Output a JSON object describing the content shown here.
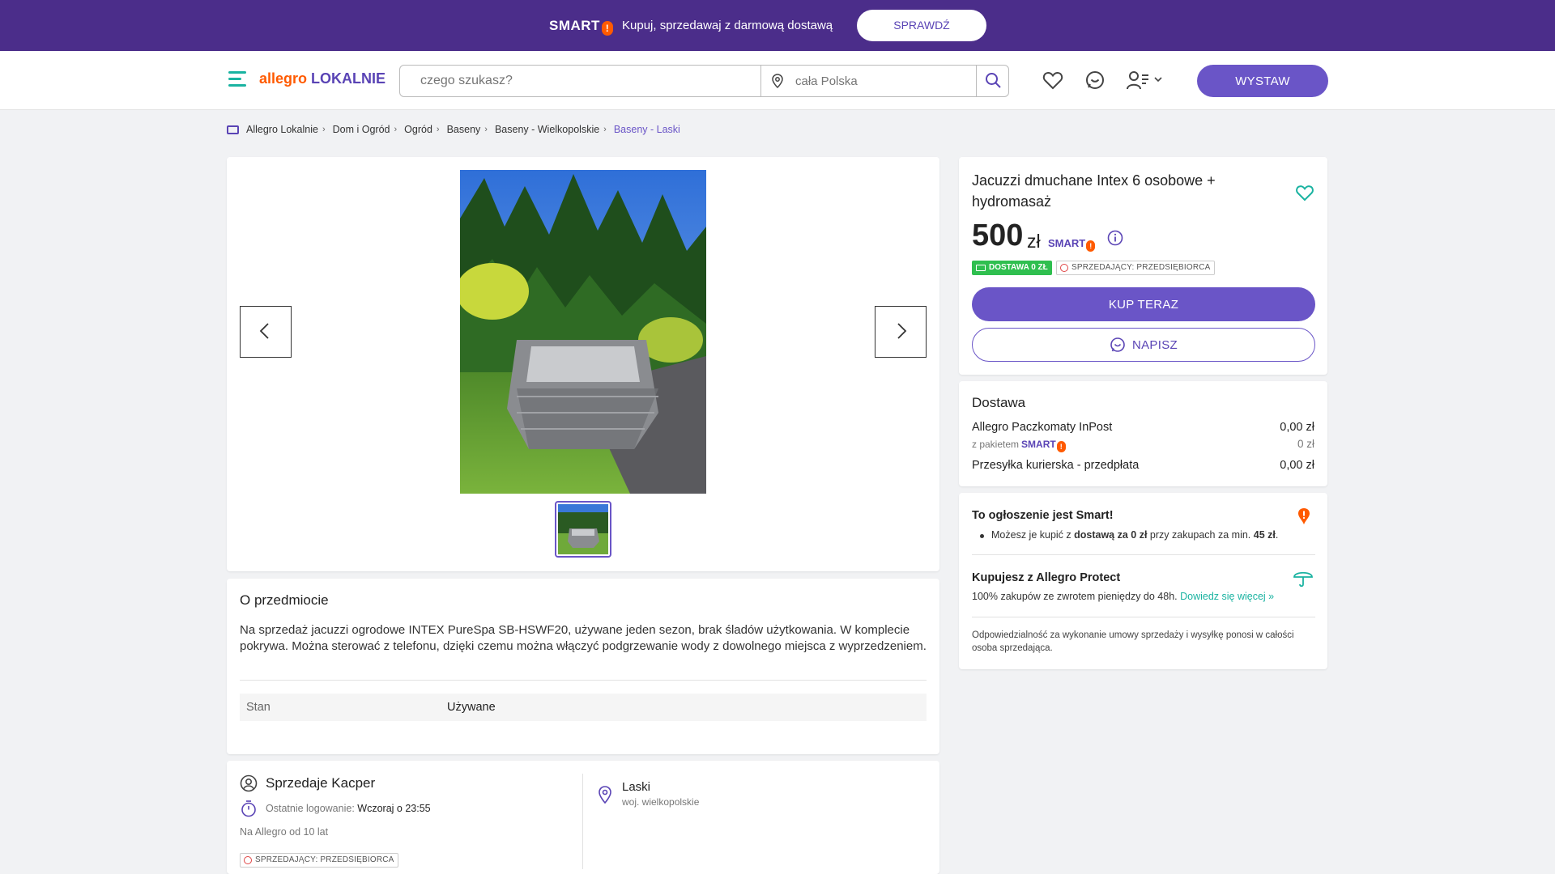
{
  "promo": {
    "smart_logo": "SMART",
    "smart_bang": "!",
    "text": "Kupuj, sprzedawaj z darmową dostawą",
    "button": "SPRAWDŹ"
  },
  "header": {
    "logo_part1": "allegro",
    "logo_part2": "LOKALNIE",
    "search_placeholder": "czego szukasz?",
    "location_placeholder": "cała Polska",
    "post_button": "WYSTAW"
  },
  "breadcrumb": [
    "Allegro Lokalnie",
    "Dom i Ogród",
    "Ogród",
    "Baseny",
    "Baseny - Wielkopolskie",
    "Baseny - Laski"
  ],
  "offer": {
    "title": "Jacuzzi dmuchane Intex 6 osobowe + hydromasaż",
    "price": "500",
    "currency": "zł",
    "smart_label": "SMART",
    "smart_bang": "!",
    "free_delivery_badge": "DOSTAWA 0 ZŁ",
    "seller_type_badge": "SPRZEDAJĄCY: PRZEDSIĘBIORCA",
    "buy_button": "KUP TERAZ",
    "message_button": "NAPISZ"
  },
  "delivery": {
    "title": "Dostawa",
    "options": [
      {
        "label": "Allegro Paczkomaty InPost",
        "price": "0,00 zł"
      },
      {
        "label": "z pakietem",
        "price": "0 zł"
      },
      {
        "label": "Przesyłka kurierska - przedpłata",
        "price": "0,00 zł"
      }
    ]
  },
  "smart_info": {
    "title": "To ogłoszenie jest Smart!",
    "bullet_pre": "Możesz je kupić z ",
    "bullet_bold": "dostawą za 0 zł",
    "bullet_mid": " przy zakupach za min. ",
    "bullet_amount": "45 zł",
    "bullet_end": ".",
    "protect_title": "Kupujesz z Allegro Protect",
    "protect_text": "100% zakupów ze zwrotem pieniędzy do 48h.",
    "protect_link": "Dowiedz się więcej »",
    "responsibility": "Odpowiedzialność za wykonanie umowy sprzedaży i wysyłkę ponosi w całości osoba sprzedająca."
  },
  "about": {
    "title": "O przedmiocie",
    "description": "Na sprzedaż jacuzzi ogrodowe INTEX PureSpa SB-HSWF20, używane jeden sezon, brak śladów użytkowania. W komplecie pokrywa. Można sterować z telefonu, dzięki czemu można włączyć podgrzewanie wody z dowolnego miejsca z wyprzedzeniem.",
    "param_key": "Stan",
    "param_value": "Używane"
  },
  "seller": {
    "name": "Sprzedaje Kacper",
    "last_login_label": "Ostatnie logowanie:",
    "last_login_value": "Wczoraj o 23:55",
    "since": "Na Allegro od 10 lat",
    "badge": "SPRZEDAJĄCY: PRZEDSIĘBIORCA",
    "city": "Laski",
    "region": "woj. wielkopolskie"
  },
  "colors": {
    "promo_bg": "#4b2d8a",
    "accent": "#6a55c7",
    "brand_orange": "#ff5a00",
    "teal": "#1ab3a1",
    "free_green": "#2fbf4f"
  }
}
